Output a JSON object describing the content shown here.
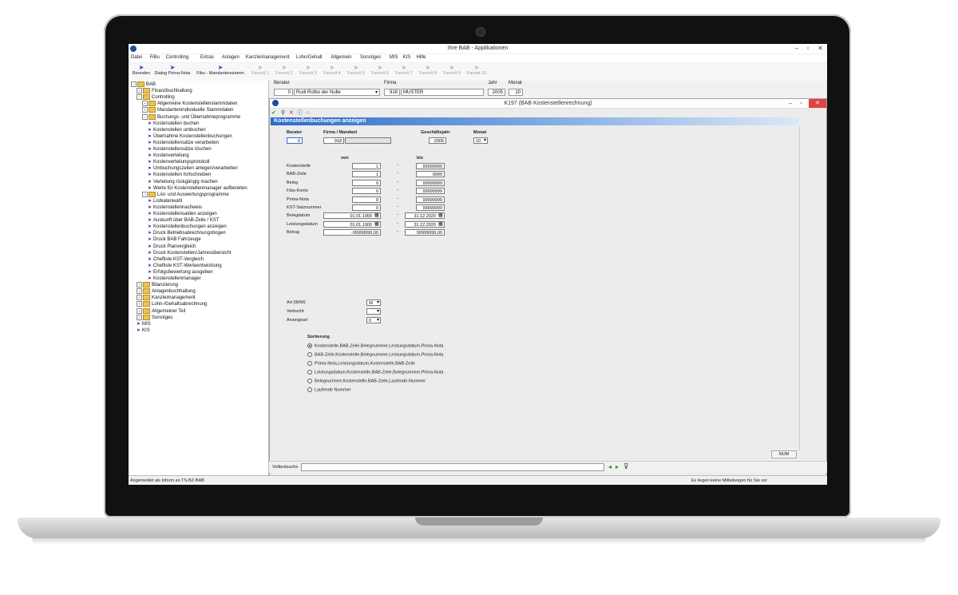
{
  "window": {
    "title": "Ihre BAB - Applikationen",
    "minimize": "–",
    "maximize": "▫",
    "close": "✕"
  },
  "menu": [
    "Datei",
    "FiBu",
    "Controlling",
    "Extras",
    "Anlagen",
    "Kanzleimanagement",
    "Lohn/Gehalt",
    "Allgemein",
    "Sonstiges",
    "MIS",
    "KIS",
    "Hilfe"
  ],
  "toolbar": {
    "buttons": [
      {
        "label": "Beenden",
        "disabled": false
      },
      {
        "label": "Dialog Prima-Nota",
        "disabled": false
      },
      {
        "label": "Fibu - Mandantenstamm",
        "disabled": false
      },
      {
        "label": "Favorit 1",
        "disabled": true
      },
      {
        "label": "Favorit 2",
        "disabled": true
      },
      {
        "label": "Favorit 3",
        "disabled": true
      },
      {
        "label": "Favorit 4",
        "disabled": true
      },
      {
        "label": "Favorit 5",
        "disabled": true
      },
      {
        "label": "Favorit 6",
        "disabled": true
      },
      {
        "label": "Favorit 7",
        "disabled": true
      },
      {
        "label": "Favorit 8",
        "disabled": true
      },
      {
        "label": "Favorit 9",
        "disabled": true
      },
      {
        "label": "Favorit 10",
        "disabled": true
      }
    ]
  },
  "tree": [
    {
      "label": "BAB",
      "level": 0,
      "type": "folder",
      "pm": "−"
    },
    {
      "label": "Finanzbuchhaltung",
      "level": 1,
      "type": "folder",
      "pm": "+"
    },
    {
      "label": "Controlling",
      "level": 1,
      "type": "folder",
      "pm": "−"
    },
    {
      "label": "Allgemeine Kostenstellenstammdaten",
      "level": 2,
      "type": "folder",
      "pm": "+"
    },
    {
      "label": "Mandantenindividuelle Stammdaten",
      "level": 2,
      "type": "folder",
      "pm": "+"
    },
    {
      "label": "Buchungs- und Übernahmeprogramme",
      "level": 2,
      "type": "folder",
      "pm": "−"
    },
    {
      "label": "Kostenstellen buchen",
      "level": 3,
      "type": "leaf"
    },
    {
      "label": "Kostenstellen umbuchen",
      "level": 3,
      "type": "leaf"
    },
    {
      "label": "Übernahme Kostenstellenbuchungen",
      "level": 3,
      "type": "leaf"
    },
    {
      "label": "Kostenstellensätze verarbeiten",
      "level": 3,
      "type": "leaf"
    },
    {
      "label": "Kostenstellensätze löschen",
      "level": 3,
      "type": "leaf"
    },
    {
      "label": "Kostenverteilung",
      "level": 3,
      "type": "leaf"
    },
    {
      "label": "Kostenverteilungsprotokoll",
      "level": 3,
      "type": "leaf"
    },
    {
      "label": "Umbuchungszeilen anlegen/verarbeiten",
      "level": 3,
      "type": "leaf"
    },
    {
      "label": "Kostenstellen fortschreiben",
      "level": 3,
      "type": "leaf"
    },
    {
      "label": "Verteilung rückgängig machen",
      "level": 3,
      "type": "leaf"
    },
    {
      "label": "Werte für Kostenstellenmanager aufbereiten",
      "level": 3,
      "type": "leaf"
    },
    {
      "label": "List- und Auswertungsprogramme",
      "level": 2,
      "type": "folder",
      "pm": "−"
    },
    {
      "label": "Listkatenwahl",
      "level": 3,
      "type": "leaf"
    },
    {
      "label": "Kostenstellennachweis",
      "level": 3,
      "type": "leaf"
    },
    {
      "label": "Kostenstellensalden anzeigen",
      "level": 3,
      "type": "leaf"
    },
    {
      "label": "Auskunft über BAB-Zeile / KST",
      "level": 3,
      "type": "leaf"
    },
    {
      "label": "Kostenstellenbuchungen anzeigen",
      "level": 3,
      "type": "leaf"
    },
    {
      "label": "Druck Betriebsabrechnungsbogen",
      "level": 3,
      "type": "leaf"
    },
    {
      "label": "Druck BAB Fahrzeuge",
      "level": 3,
      "type": "leaf"
    },
    {
      "label": "Druck Planvergleich",
      "level": 3,
      "type": "leaf"
    },
    {
      "label": "Druck Kostenstellen/Jahresübersicht",
      "level": 3,
      "type": "leaf"
    },
    {
      "label": "Chefliste KST-Vergleich",
      "level": 3,
      "type": "leaf"
    },
    {
      "label": "Chefliste KST-Werteentwicklung",
      "level": 3,
      "type": "leaf"
    },
    {
      "label": "Erfolgsbewertung ausgeben",
      "level": 3,
      "type": "leaf"
    },
    {
      "label": "Kostenstellenmanager",
      "level": 3,
      "type": "leaf"
    },
    {
      "label": "Bilanzierung",
      "level": 1,
      "type": "folder",
      "pm": "+"
    },
    {
      "label": "Anlagenbuchhaltung",
      "level": 1,
      "type": "folder",
      "pm": "+"
    },
    {
      "label": "Kanzleimanagement",
      "level": 1,
      "type": "folder",
      "pm": "+"
    },
    {
      "label": "Lohn-/Gehaltsabrechnung",
      "level": 1,
      "type": "folder",
      "pm": "+"
    },
    {
      "label": "Allgemeiner Teil",
      "level": 1,
      "type": "folder",
      "pm": "+"
    },
    {
      "label": "Sonstiges",
      "level": 1,
      "type": "folder",
      "pm": "+"
    },
    {
      "label": "MIS",
      "level": 1,
      "type": "leaf"
    },
    {
      "label": "KIS",
      "level": 1,
      "type": "leaf"
    }
  ],
  "header": {
    "berater_label": "Berater",
    "berater_no": "0",
    "berater_name": "Rudi Rotbo der Nulle",
    "firma_label": "Firma",
    "firma_no": "918",
    "firma_name": "MUSTER",
    "jahr_label": "Jahr",
    "jahr": "2005",
    "monat_label": "Monat",
    "monat": "10"
  },
  "inner": {
    "title": "K197 (BAB Kostenstellenrechnung)",
    "form_title": "Kostenstellenbuchungen anzeigen",
    "berater_label": "Berater",
    "berater_value": "0",
    "firma_label": "Firma / Mandant",
    "firma_value": "918",
    "gj_label": "Geschäftsjahr",
    "gj_value": "2005",
    "monat_label": "Monat",
    "monat_value": "10",
    "von_label": "von",
    "bis_label": "bis",
    "rows": [
      {
        "label": "Kostenstelle",
        "von": "1",
        "bis": "99999999"
      },
      {
        "label": "BAB-Zeile",
        "von": "1",
        "bis": "9999"
      },
      {
        "label": "Beleg",
        "von": "0",
        "bis": "99999999"
      },
      {
        "label": "Fibu-Konto",
        "von": "0",
        "bis": "99999999"
      },
      {
        "label": "Prima-Nota",
        "von": "0",
        "bis": "99999999"
      },
      {
        "label": "KST-Satznummer",
        "von": "0",
        "bis": "99999999"
      },
      {
        "label": "Belegdatum",
        "von": "01.01.1900",
        "bis": "31.12.2020"
      },
      {
        "label": "Leistungsdatum",
        "von": "01.01.1900",
        "bis": "31.12.2020"
      },
      {
        "label": "Betrag",
        "von": "-99999999,00",
        "bis": "99999999,00"
      }
    ],
    "art_label": "Art (W/M)",
    "art_value": "W",
    "verbucht_label": "Verbucht",
    "verbucht_value": "",
    "anzeigeart_label": "Anzeigeart",
    "anzeigeart_value": "0",
    "sortierung_label": "Sortierung",
    "sort_options": [
      "Kostenstelle,BAB-Zeile,Belegnummer,Leistungsdatum,Prima-Nota",
      "BAB-Zeile,Kostenstelle,Belegnummer,Leistungsdatum,Prima-Nota",
      "Prima-Nota,Leistungsdatum,Kostenstelle,BAB-Zeile",
      "Leistungsdatum,Kostenstelle,BAB-Zeile,Belegnummer,Prima-Nota",
      "Belegnummer,Kostenstelle,BAB-Zeile,Laufende-Nummer",
      "Laufende Nummer"
    ],
    "sort_selected": 0,
    "num_indicator": "NUM"
  },
  "search": {
    "label": "Volltextsuche",
    "value": "",
    "prev": "◂",
    "next": "▸",
    "filter": "⊽"
  },
  "status": {
    "left": "Angemeldet als Inform an TS-BZ-BAB",
    "right": "Es liegen keine Mitteilungen für Sie vor"
  }
}
